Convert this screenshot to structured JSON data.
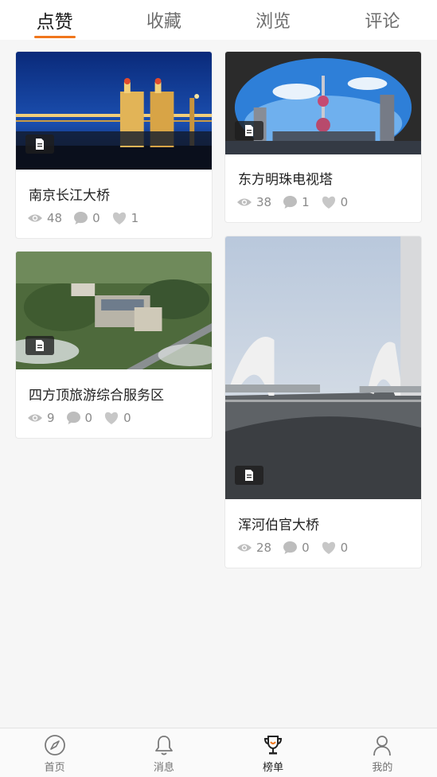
{
  "tabs": [
    {
      "label": "点赞",
      "active": true
    },
    {
      "label": "收藏",
      "active": false
    },
    {
      "label": "浏览",
      "active": false
    },
    {
      "label": "评论",
      "active": false
    }
  ],
  "accent_color": "#f0761c",
  "cards": [
    {
      "title": "南京长江大桥",
      "views": "48",
      "comments": "0",
      "likes": "1",
      "type_icon": "document-icon"
    },
    {
      "title": "东方明珠电视塔",
      "views": "38",
      "comments": "1",
      "likes": "0",
      "type_icon": "document-icon"
    },
    {
      "title": "四方顶旅游综合服务区",
      "views": "9",
      "comments": "0",
      "likes": "0",
      "type_icon": "document-icon"
    },
    {
      "title": "浑河伯官大桥",
      "views": "28",
      "comments": "0",
      "likes": "0",
      "type_icon": "document-icon"
    }
  ],
  "nav": [
    {
      "label": "首页",
      "icon": "compass-icon",
      "active": false
    },
    {
      "label": "消息",
      "icon": "bell-icon",
      "active": false
    },
    {
      "label": "榜单",
      "icon": "trophy-icon",
      "active": true
    },
    {
      "label": "我的",
      "icon": "user-icon",
      "active": false
    }
  ]
}
